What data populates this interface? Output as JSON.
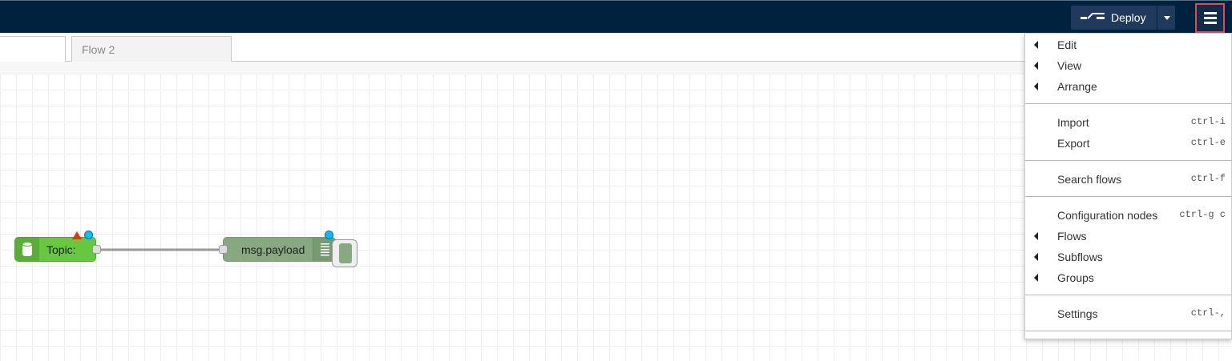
{
  "header": {
    "deploy_label": "Deploy"
  },
  "tabs": [
    {
      "label": ""
    },
    {
      "label": "Flow 2"
    }
  ],
  "nodes": {
    "inject": {
      "label": "Topic:"
    },
    "debug": {
      "label": "msg.payload"
    }
  },
  "menu": {
    "items": [
      {
        "label": "Edit",
        "shortcut": "",
        "submenu": true
      },
      {
        "label": "View",
        "shortcut": "",
        "submenu": true
      },
      {
        "label": "Arrange",
        "shortcut": "",
        "submenu": true
      },
      {
        "label": "Import",
        "shortcut": "ctrl-i",
        "submenu": false
      },
      {
        "label": "Export",
        "shortcut": "ctrl-e",
        "submenu": false
      },
      {
        "label": "Search flows",
        "shortcut": "ctrl-f",
        "submenu": false
      },
      {
        "label": "Configuration nodes",
        "shortcut": "ctrl-g c",
        "submenu": false
      },
      {
        "label": "Flows",
        "shortcut": "",
        "submenu": true
      },
      {
        "label": "Subflows",
        "shortcut": "",
        "submenu": true
      },
      {
        "label": "Groups",
        "shortcut": "",
        "submenu": true
      },
      {
        "label": "Settings",
        "shortcut": "ctrl-,",
        "submenu": false
      }
    ]
  },
  "colors": {
    "header_bg": "#00223f",
    "menu_button_highlight": "#e04a58",
    "inject_node": "#67c73f",
    "debug_node": "#87a980",
    "changed_dot": "#00bfff",
    "warning": "#e03c00"
  },
  "icons": {
    "deploy": "deploy-icon",
    "menu": "hamburger-menu-icon",
    "inject": "database-icon",
    "debug": "list-icon",
    "submenu": "caret-left-icon"
  }
}
